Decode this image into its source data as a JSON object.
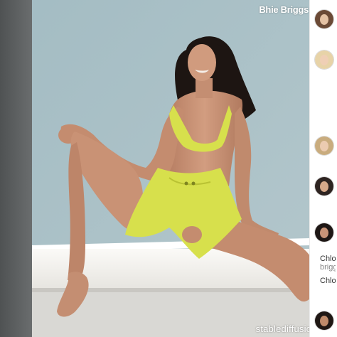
{
  "image": {
    "caption": "Bhie Briggs",
    "watermark": "stablediffusionweb"
  },
  "side_rail": {
    "avatars": [
      {
        "name": "avatar-1",
        "hair": "#6b4a36",
        "skin": "#e5c2a4"
      },
      {
        "name": "avatar-2",
        "hair": "#e7d3a8",
        "skin": "#efcfb5"
      },
      {
        "name": "avatar-3",
        "hair": "#c9ac7e",
        "skin": "#ebcbb1"
      },
      {
        "name": "avatar-4",
        "hair": "#2e2421",
        "skin": "#d6a98a"
      },
      {
        "name": "avatar-5",
        "hair": "#1e1715",
        "skin": "#c99478"
      },
      {
        "name": "avatar-6",
        "hair": "#1f1714",
        "skin": "#bf8a6a"
      }
    ],
    "label_line_1": "Chlo",
    "label_line_2": "brigg",
    "label_line_3": "Chlo"
  },
  "colors": {
    "backdrop": "#a9c0c6",
    "outfit": "#d7e04c",
    "skin": "#c99275",
    "hair": "#1d1512",
    "bench": "#f3f2ee",
    "wall": "#5a5d5e"
  }
}
